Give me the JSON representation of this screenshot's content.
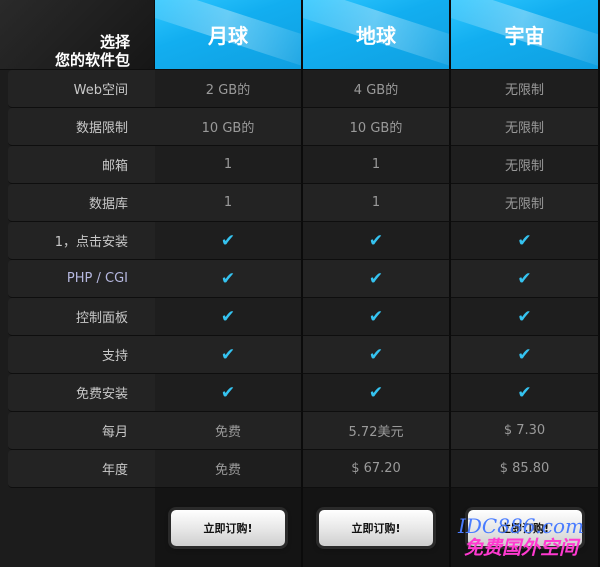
{
  "corner": {
    "line1": "选择",
    "line2": "您的软件包"
  },
  "plans": [
    "月球",
    "地球",
    "宇宙"
  ],
  "rows": [
    {
      "label": "Web空间",
      "values": [
        "2 GB的",
        "4 GB的",
        "无限制"
      ]
    },
    {
      "label": "数据限制",
      "values": [
        "10 GB的",
        "10 GB的",
        "无限制"
      ]
    },
    {
      "label": "邮箱",
      "values": [
        "1",
        "1",
        "无限制"
      ]
    },
    {
      "label": "数据库",
      "values": [
        "1",
        "1",
        "无限制"
      ]
    },
    {
      "label": "1，点击安装",
      "values": [
        "✔",
        "✔",
        "✔"
      ]
    },
    {
      "label": "PHP / CGI",
      "values": [
        "✔",
        "✔",
        "✔"
      ]
    },
    {
      "label": "控制面板",
      "values": [
        "✔",
        "✔",
        "✔"
      ]
    },
    {
      "label": "支持",
      "values": [
        "✔",
        "✔",
        "✔"
      ]
    },
    {
      "label": "免费安装",
      "values": [
        "✔",
        "✔",
        "✔"
      ]
    },
    {
      "label": "每月",
      "values": [
        "免费",
        "5.72美元",
        "$ 7.30"
      ]
    },
    {
      "label": "年度",
      "values": [
        "免费",
        "$ 67.20",
        "$ 85.80"
      ]
    }
  ],
  "buy_label": "立即订购!",
  "watermark": {
    "url": "IDC886.com",
    "name": "免费国外空间"
  },
  "colors": {
    "header": "#12aef0",
    "check": "#35c3f0"
  }
}
